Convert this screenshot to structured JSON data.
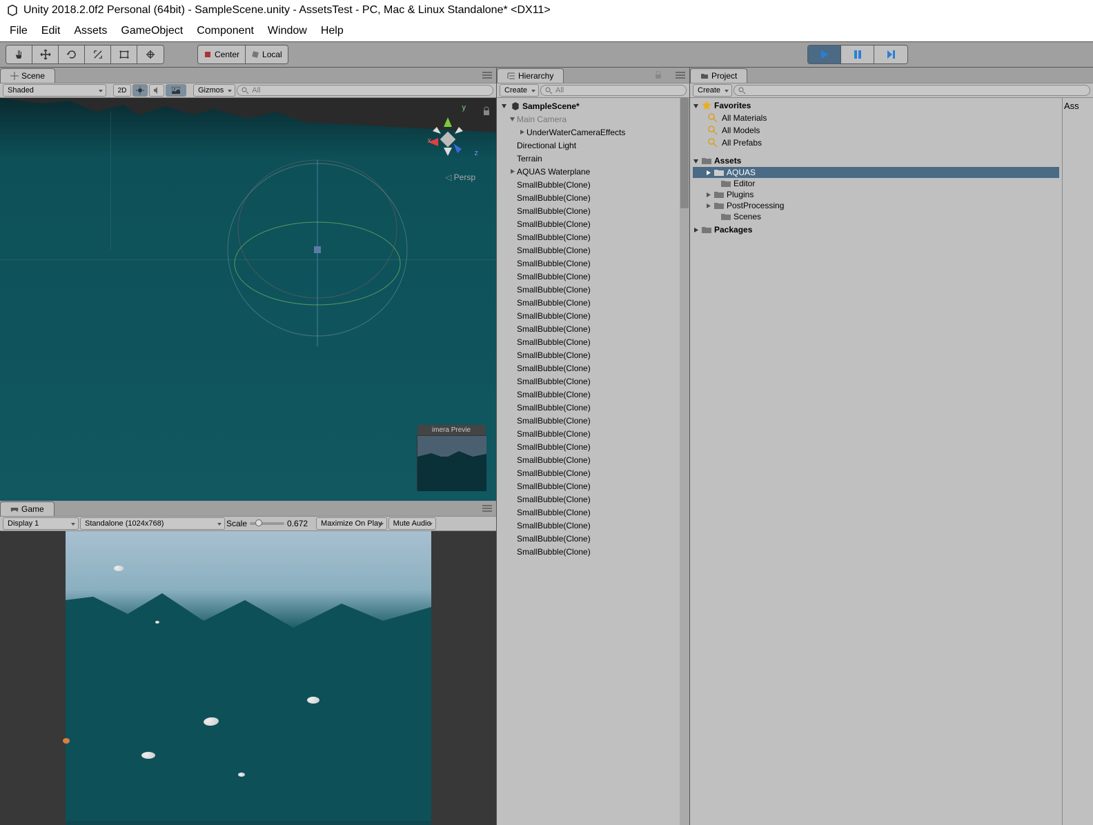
{
  "title": "Unity 2018.2.0f2 Personal (64bit) - SampleScene.unity - AssetsTest - PC, Mac & Linux Standalone* <DX11>",
  "menu": [
    "File",
    "Edit",
    "Assets",
    "GameObject",
    "Component",
    "Window",
    "Help"
  ],
  "toolbar": {
    "center": "Center",
    "local": "Local"
  },
  "scene": {
    "tab": "Scene",
    "shading": "Shaded",
    "btn2d": "2D",
    "gizmos": "Gizmos",
    "search_placeholder": "All",
    "persp": "Persp",
    "axis_x": "x",
    "axis_y": "y",
    "axis_z": "z",
    "preview_label": "imera Previe"
  },
  "game": {
    "tab": "Game",
    "display": "Display 1",
    "aspect": "Standalone (1024x768)",
    "scale_label": "Scale",
    "scale_value": "0.672",
    "max": "Maximize On Play",
    "mute": "Mute Audio"
  },
  "hierarchy": {
    "tab": "Hierarchy",
    "create": "Create",
    "search_placeholder": "All",
    "scene": "SampleScene*",
    "items": [
      {
        "label": "Main Camera",
        "arrow": true,
        "dim": true,
        "indent": 14,
        "open": true
      },
      {
        "label": "UnderWaterCameraEffects",
        "arrow": true,
        "indent": 28
      },
      {
        "label": "Directional Light",
        "indent": 14
      },
      {
        "label": "Terrain",
        "indent": 14
      },
      {
        "label": "AQUAS Waterplane",
        "arrow": true,
        "indent": 14
      }
    ],
    "clone": "SmallBubble(Clone)",
    "clone_count": 29
  },
  "project": {
    "tab": "Project",
    "create": "Create",
    "favorites": "Favorites",
    "fav_items": [
      "All Materials",
      "All Models",
      "All Prefabs"
    ],
    "assets": "Assets",
    "folders": [
      {
        "label": "AQUAS",
        "sel": true,
        "arrow": true,
        "indent": 18
      },
      {
        "label": "Editor",
        "indent": 28
      },
      {
        "label": "Plugins",
        "arrow": true,
        "indent": 18
      },
      {
        "label": "PostProcessing",
        "arrow": true,
        "indent": 18
      },
      {
        "label": "Scenes",
        "indent": 28
      }
    ],
    "packages": "Packages",
    "side": "Ass"
  }
}
